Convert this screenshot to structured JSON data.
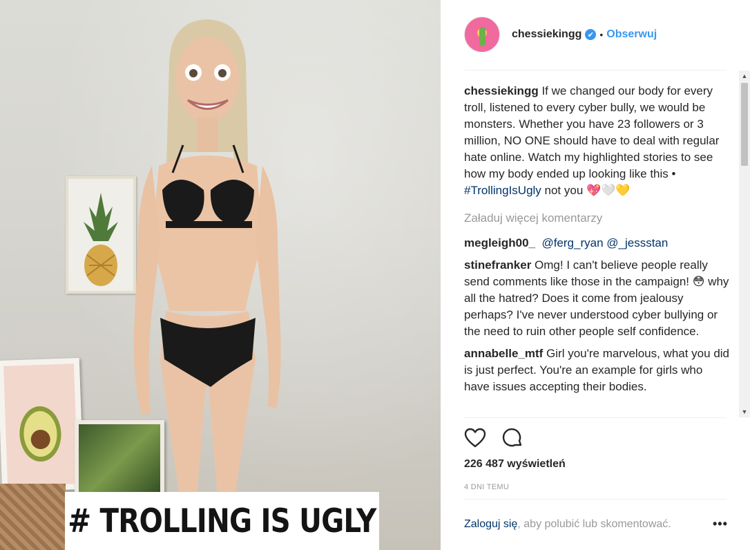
{
  "media": {
    "caption": "# TROLLING IS UGLY"
  },
  "header": {
    "username": "chessiekingg",
    "verified_icon": "✔",
    "separator": "•",
    "follow_label": "Obserwuj"
  },
  "caption_comment": {
    "username": "chessiekingg",
    "text": " If we changed our body for every troll, listened to every cyber bully, we would be monsters. Whether you have 23 followers or 3 million, NO ONE should have to deal with regular hate online. Watch my highlighted stories to see how my body ended up looking like this • ",
    "hashtag": "#TrollingIsUgly",
    "text_end": " not you 💖🤍💛"
  },
  "load_more": "Załaduj więcej komentarzy",
  "comments": [
    {
      "username": "megleigh00_",
      "mention1": "@ferg_ryan",
      "mention2": "@_jessstan"
    },
    {
      "username": "stinefranker",
      "text": " Omg! I can't believe people really send comments like those in the campaign! 😳 why all the hatred? Does it come from jealousy perhaps? I've never understood cyber bullying or the need to ruin other people self confidence."
    },
    {
      "username": "annabelle_mtf",
      "text": " Girl you're marvelous, what you did is just perfect. You're an example for girls who have issues accepting their bodies."
    }
  ],
  "actions": {
    "like_icon": "heart-icon",
    "comment_icon": "comment-icon"
  },
  "views": "226 487 wyświetleń",
  "timestamp": "4 DNI TEMU",
  "login": {
    "link": "Zaloguj się",
    "text": ", aby polubić lub skomentować.",
    "more": "•••"
  },
  "colors": {
    "accent": "#3897f0",
    "link": "#003569",
    "muted": "#999999"
  }
}
